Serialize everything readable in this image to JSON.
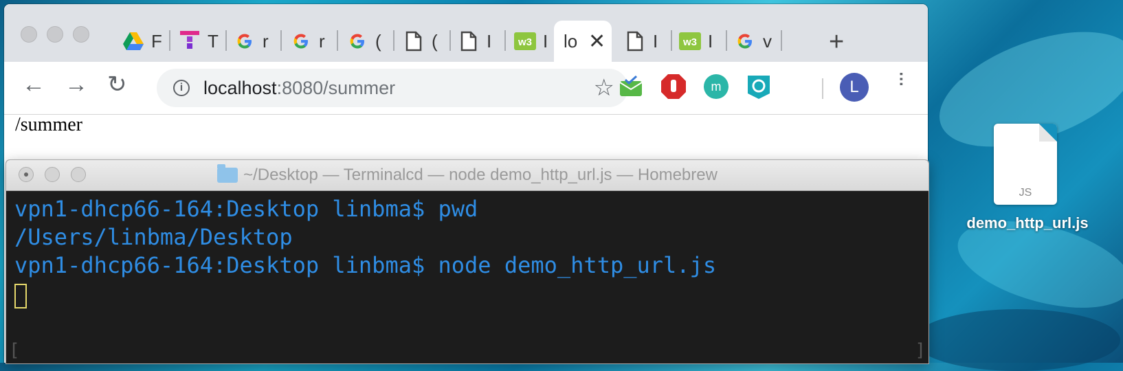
{
  "browser": {
    "tabs": [
      {
        "icon": "google-drive-icon",
        "label": "F"
      },
      {
        "icon": "todoist-icon",
        "label": "T"
      },
      {
        "icon": "google-icon",
        "label": "r"
      },
      {
        "icon": "google-icon",
        "label": "r"
      },
      {
        "icon": "google-icon",
        "label": "("
      },
      {
        "icon": "document-icon",
        "label": "("
      },
      {
        "icon": "document-icon",
        "label": "I"
      },
      {
        "icon": "w3schools-icon",
        "label": "I"
      },
      {
        "icon": "none",
        "label": "lo",
        "active": true,
        "close": "✕"
      },
      {
        "icon": "document-icon",
        "label": "I"
      },
      {
        "icon": "w3schools-icon",
        "label": "I"
      },
      {
        "icon": "google-icon",
        "label": "v"
      }
    ],
    "new_tab": "+",
    "url_host": "localhost",
    "url_rest": ":8080/summer",
    "profile_initial": "L",
    "page_text": "/summer"
  },
  "terminal": {
    "title": "~/Desktop — Terminalcd  — node demo_http_url.js — Homebrew",
    "lines": [
      "vpn1-dhcp66-164:Desktop linbma$ pwd",
      "/Users/linbma/Desktop",
      "vpn1-dhcp66-164:Desktop linbma$ node demo_http_url.js"
    ]
  },
  "desktop": {
    "file_ext": "JS",
    "file_name": "demo_http_url.js"
  }
}
